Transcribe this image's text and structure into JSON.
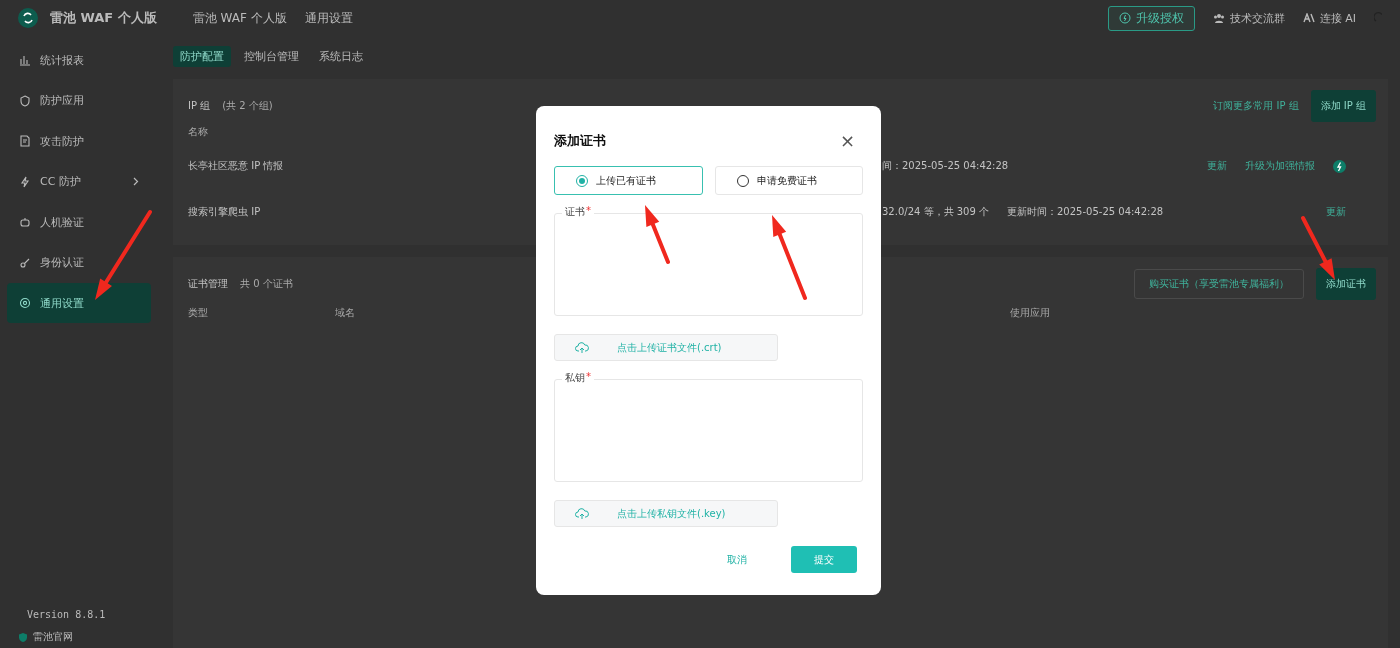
{
  "app": {
    "name": "雷池 WAF 个人版"
  },
  "breadcrumb": [
    "雷池 WAF 个人版",
    "通用设置"
  ],
  "header_actions": [
    {
      "kind": "upgrade",
      "label": "升级授权"
    },
    {
      "kind": "group",
      "label": "技术交流群"
    },
    {
      "kind": "ai",
      "label": "连接 AI"
    }
  ],
  "sidebar": {
    "items": [
      {
        "label": "统计报表",
        "selected": false,
        "chevron": false
      },
      {
        "label": "防护应用",
        "selected": false,
        "chevron": false
      },
      {
        "label": "攻击防护",
        "selected": false,
        "chevron": false
      },
      {
        "label": "CC 防护",
        "selected": false,
        "chevron": true
      },
      {
        "label": "人机验证",
        "selected": false,
        "chevron": false
      },
      {
        "label": "身份认证",
        "selected": false,
        "chevron": false
      },
      {
        "label": "通用设置",
        "selected": true,
        "chevron": false
      }
    ],
    "version": "Version 8.8.1",
    "site_link": "雷池官网"
  },
  "tabs": [
    {
      "label": "防护配置",
      "selected": true
    },
    {
      "label": "控制台管理",
      "selected": false
    },
    {
      "label": "系统日志",
      "selected": false
    }
  ],
  "ip_group": {
    "title": "IP 组",
    "count": "(共 2 个组)",
    "link": "订阅更多常用 IP 组",
    "button": "添加 IP 组",
    "columns": [
      "名称"
    ],
    "rows": [
      {
        "name": "长亭社区恶意 IP 情报",
        "details": [
          "间：2025-05-25 04:42:28"
        ],
        "actions": [
          "更新",
          "升级为加强情报"
        ],
        "badge": true
      },
      {
        "name": "搜索引擎爬虫 IP",
        "details": [
          "32.0/24 等，共 309 个",
          "更新时间：2025-05-25 04:42:28"
        ],
        "actions": [
          "更新"
        ],
        "badge": false
      }
    ]
  },
  "certificates": {
    "title": "证书管理",
    "count": "共 0 个证书",
    "buy_button": "购买证书（享受雷池专属福利）",
    "add_button": "添加证书",
    "columns": [
      "类型",
      "域名",
      "使用应用"
    ]
  },
  "dialog": {
    "title": "添加证书",
    "close": "×",
    "modes": [
      {
        "label": "上传已有证书",
        "selected": true
      },
      {
        "label": "申请免费证书",
        "selected": false
      }
    ],
    "fields": [
      {
        "label": "证书",
        "required_mark": "*",
        "upload": "点击上传证书文件(.crt)"
      },
      {
        "label": "私钥",
        "required_mark": "*",
        "upload": "点击上传私钥文件(.key)"
      }
    ],
    "cancel": "取消",
    "submit": "提交"
  }
}
